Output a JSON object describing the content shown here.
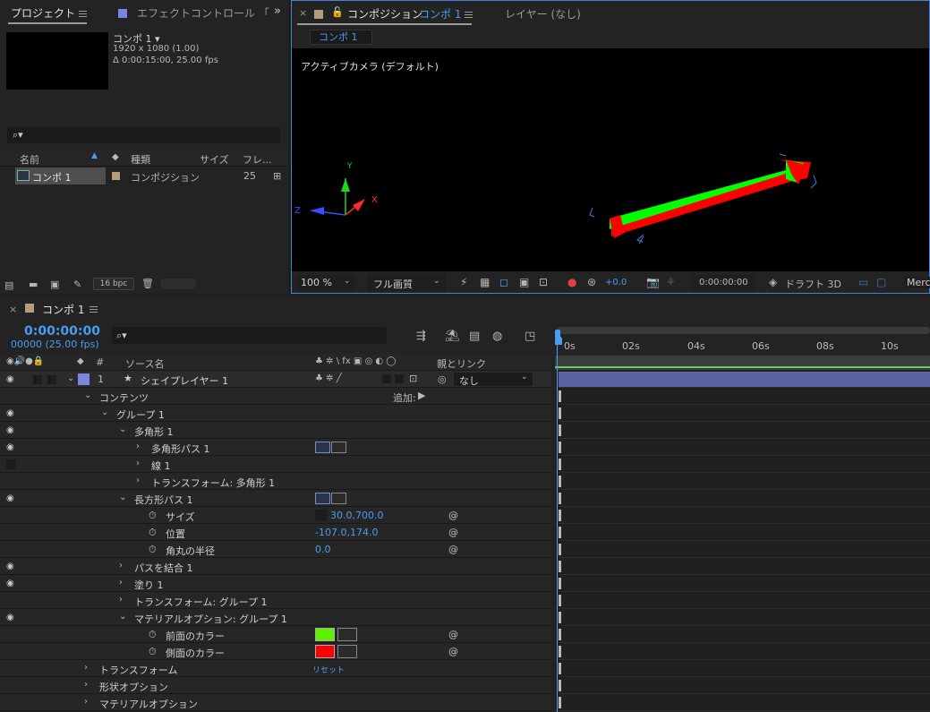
{
  "project": {
    "tab_label": "プロジェクト",
    "effect_tab_label": "エフェクトコントロール 「",
    "overflow": "»",
    "comp_name": "コンポ 1 ▾",
    "comp_res": "1920 x 1080 (1.00)",
    "comp_dur": "Δ 0:00:15:00, 25.00 fps",
    "search_icon": "⌕▾",
    "col_name": "名前",
    "col_type": "種類",
    "col_size": "サイズ",
    "col_frame": "フレ...",
    "item_name": "コンポ 1",
    "item_type": "コンポジション",
    "item_fps": "25",
    "bpc": "16 bpc"
  },
  "composition": {
    "close": "×",
    "tab_label": "コンポジション",
    "tab_comp": "コンポ 1",
    "layer_tab": "レイヤー (なし)",
    "subtab": "コンポ 1",
    "camera_label": "アクティブカメラ (デフォルト)",
    "axis_x": "X",
    "axis_y": "Y",
    "axis_z": "Z",
    "zoom": "100 %",
    "quality": "フル画質",
    "exposure": "+0.0",
    "timecode": "0:00:00:00",
    "draft": "ドラフト 3D",
    "renderer": "Mercu"
  },
  "timeline": {
    "close": "×",
    "tab_label": "コンポ 1",
    "timecode": "0:00:00:00",
    "frames": "00000 (25.00 fps)",
    "search_icon": "⌕▾",
    "col_num": "#",
    "col_source": "ソース名",
    "col_parent": "親とリンク",
    "switch_icons": "♣ ✲ \\ fx ▣ ◎ ◐ ◯",
    "ruler": [
      "0s",
      "02s",
      "04s",
      "06s",
      "08s",
      "10s"
    ],
    "layer_num": "1",
    "layer_name": "シェイプレイヤー 1",
    "parent_value": "なし",
    "add_label": "追加:",
    "reset_label": "リセット",
    "rows": [
      {
        "label": "コンテンツ"
      },
      {
        "label": "グループ 1"
      },
      {
        "label": "多角形 1"
      },
      {
        "label": "多角形パス 1"
      },
      {
        "label": "線 1"
      },
      {
        "label": "トランスフォーム: 多角形 1"
      },
      {
        "label": "長方形パス 1"
      },
      {
        "label": "サイズ",
        "value": "30.0,700.0"
      },
      {
        "label": "位置",
        "value": "-107.0,174.0"
      },
      {
        "label": "角丸の半径",
        "value": "0.0"
      },
      {
        "label": "パスを結合 1"
      },
      {
        "label": "塗り 1"
      },
      {
        "label": "トランスフォーム: グループ 1"
      },
      {
        "label": "マテリアルオプション: グループ 1"
      },
      {
        "label": "前面のカラー"
      },
      {
        "label": "側面のカラー"
      },
      {
        "label": "トランスフォーム"
      },
      {
        "label": "形状オプション"
      },
      {
        "label": "マテリアルオプション"
      }
    ],
    "front_color": "#5ef000",
    "side_color": "#ff0000",
    "layer_color": "#7b86e0"
  },
  "colors": {
    "accent": "#4a9cf0",
    "layer_bar": "#5b63a6",
    "work_bar": "#5dd05d"
  }
}
